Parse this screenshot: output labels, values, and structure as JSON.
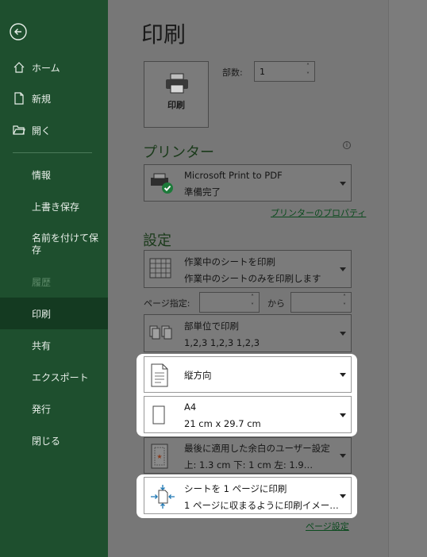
{
  "sidebar": {
    "items": [
      {
        "label": "ホーム"
      },
      {
        "label": "新規"
      },
      {
        "label": "開く"
      },
      {
        "label": "情報"
      },
      {
        "label": "上書き保存"
      },
      {
        "label": "名前を付けて保存"
      },
      {
        "label": "履歴"
      },
      {
        "label": "印刷"
      },
      {
        "label": "共有"
      },
      {
        "label": "エクスポート"
      },
      {
        "label": "発行"
      },
      {
        "label": "閉じる"
      }
    ]
  },
  "main": {
    "title": "印刷",
    "print_button_label": "印刷",
    "copies_label": "部数:",
    "copies_value": "1",
    "printer_section": "プリンター",
    "printer": {
      "name": "Microsoft Print to PDF",
      "status": "準備完了"
    },
    "printer_properties_link": "プリンターのプロパティ",
    "settings_section": "設定",
    "print_what": {
      "line1": "作業中のシートを印刷",
      "line2": "作業中のシートのみを印刷します"
    },
    "pages_label": "ページ指定:",
    "pages_from_value": "",
    "pages_to_label": "から",
    "pages_to_value": "",
    "collate": {
      "line1": "部単位で印刷",
      "line2": "1,2,3    1,2,3    1,2,3"
    },
    "orientation": {
      "line1": "縦方向"
    },
    "paper": {
      "line1": "A4",
      "line2": "21 cm x 29.7 cm"
    },
    "margins": {
      "line1": "最後に適用した余白のユーザー設定",
      "line2": "上: 1.3 cm 下: 1 cm 左: 1.9…"
    },
    "scaling": {
      "line1": "シートを 1 ページに印刷",
      "line2": "1 ページに収まるように印刷イメー…"
    },
    "page_setup_link": "ページ設定"
  },
  "colors": {
    "sidebar_bg": "#1e4f2e",
    "sidebar_active": "#143a21",
    "content_bg": "#777777",
    "accent": "#217346"
  }
}
